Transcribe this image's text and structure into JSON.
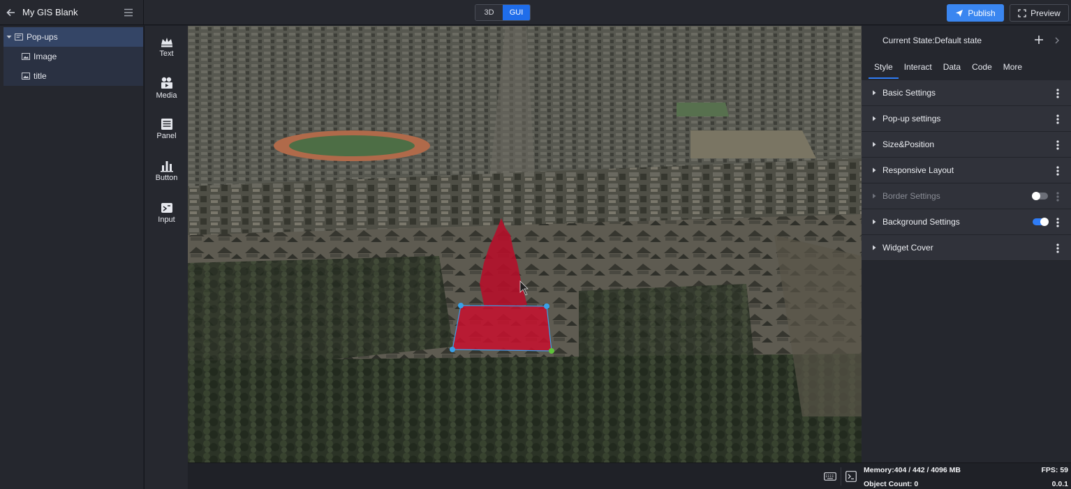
{
  "app": {
    "title": "My GIS Blank"
  },
  "mode_toggle": {
    "options": [
      "3D",
      "GUI"
    ],
    "active": "GUI"
  },
  "actions": {
    "publish": "Publish",
    "preview": "Preview"
  },
  "layers": [
    {
      "label": "Pop-ups",
      "type": "group",
      "selected": true
    },
    {
      "label": "Image",
      "type": "image"
    },
    {
      "label": "title",
      "type": "image"
    }
  ],
  "widgets": [
    {
      "label": "Text",
      "icon": "text-icon"
    },
    {
      "label": "Media",
      "icon": "media-icon"
    },
    {
      "label": "Panel",
      "icon": "panel-icon"
    },
    {
      "label": "Button",
      "icon": "button-chart-icon"
    },
    {
      "label": "Input",
      "icon": "input-icon"
    }
  ],
  "properties": {
    "state_label": "Current State:Default state",
    "tabs": [
      "Style",
      "Interact",
      "Data",
      "Code",
      "More"
    ],
    "active_tab": "Style",
    "sections": [
      {
        "label": "Basic Settings"
      },
      {
        "label": "Pop-up settings"
      },
      {
        "label": "Size&Position"
      },
      {
        "label": "Responsive Layout"
      },
      {
        "label": "Border Settings",
        "toggle": false,
        "disabled": true
      },
      {
        "label": "Background Settings",
        "toggle": true
      },
      {
        "label": "Widget Cover"
      }
    ]
  },
  "status": {
    "memory": "Memory:404 / 442 / 4096 MB",
    "fps": "FPS: 59",
    "object_count": "Object Count: 0",
    "version": "0.0.1"
  },
  "colors": {
    "accent": "#1f6dea",
    "publish": "#3a86f0",
    "selection": "#344566",
    "highlight_volume": "#c8102e",
    "handle_blue": "#3aa0e8",
    "handle_green": "#5ec23a"
  }
}
